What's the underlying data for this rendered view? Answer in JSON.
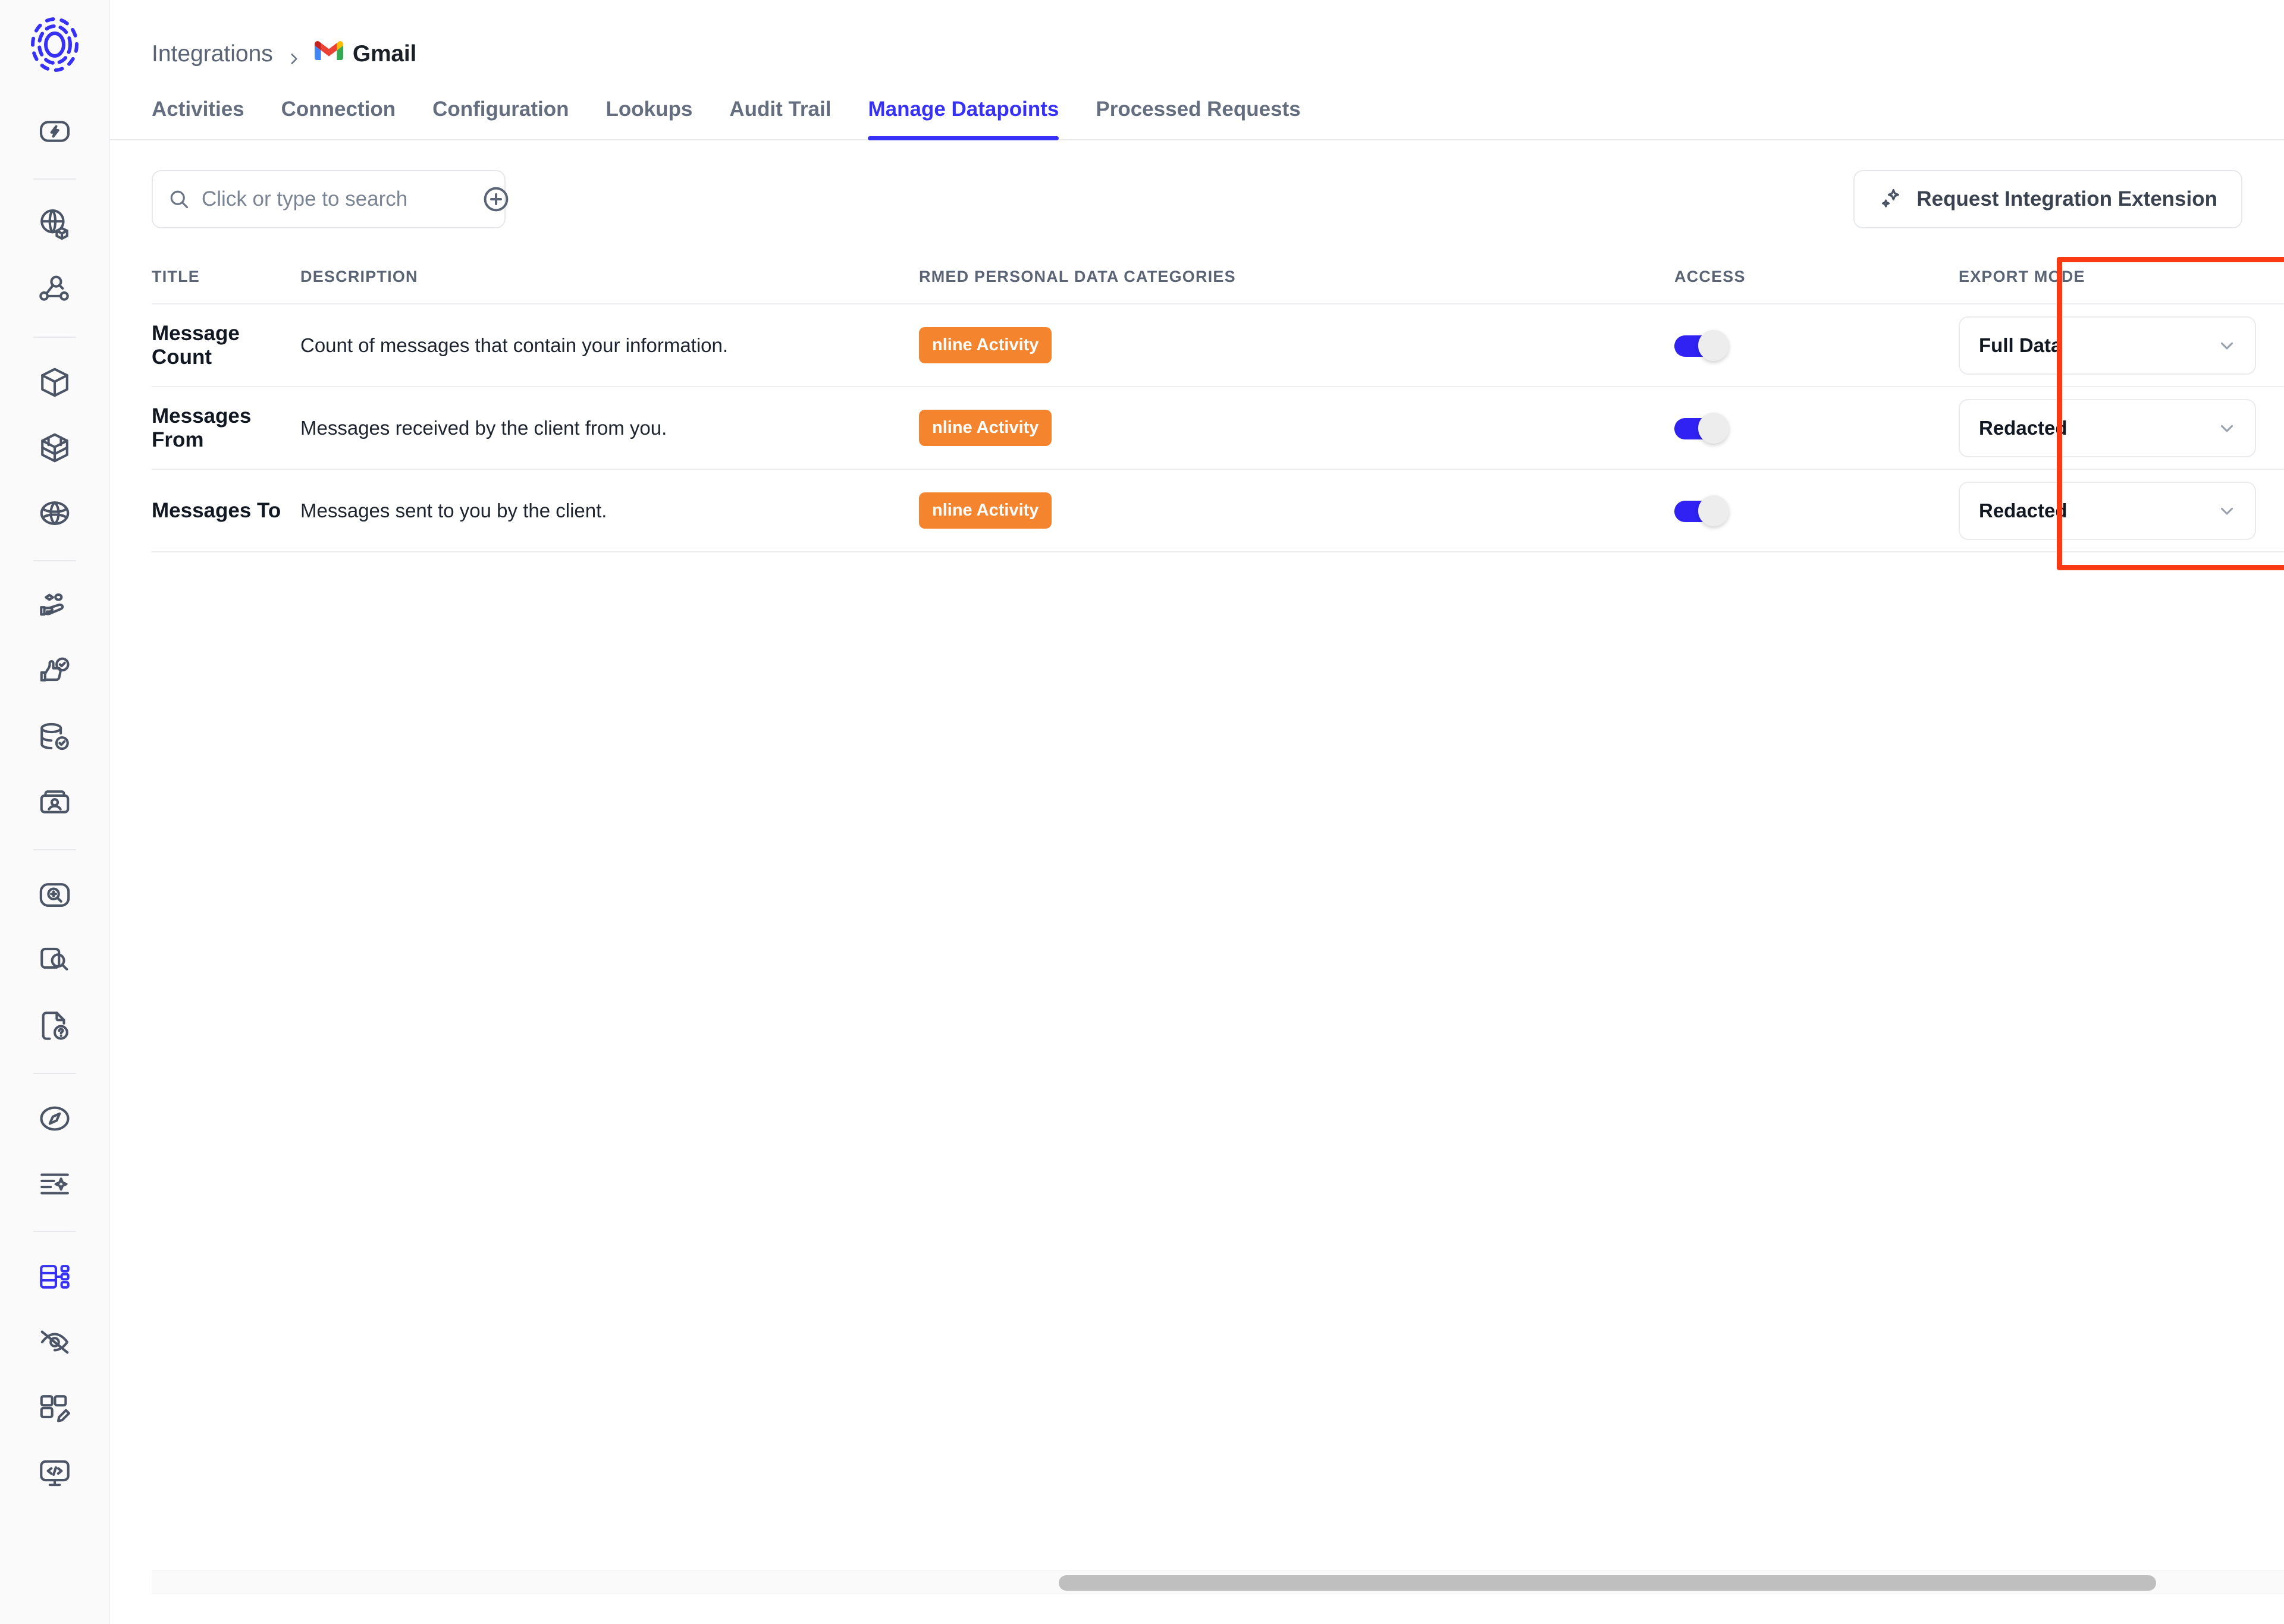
{
  "sidebar": {
    "logo_name": "company-logo",
    "groups": [
      {
        "items": [
          {
            "icon": "lightning-badge-icon",
            "name": "sidebar-item-automation"
          }
        ]
      },
      {
        "items": [
          {
            "icon": "globe-package-icon",
            "name": "sidebar-item-data-mapping"
          },
          {
            "icon": "node-search-icon",
            "name": "sidebar-item-discovery"
          }
        ]
      },
      {
        "items": [
          {
            "icon": "cube-icon",
            "name": "sidebar-item-assets"
          },
          {
            "icon": "grid-cube-icon",
            "name": "sidebar-item-inventory"
          },
          {
            "icon": "globe-icon",
            "name": "sidebar-item-global"
          }
        ]
      },
      {
        "items": [
          {
            "icon": "hand-data-icon",
            "name": "sidebar-item-consent"
          },
          {
            "icon": "thumbs-up-check-icon",
            "name": "sidebar-item-approvals"
          },
          {
            "icon": "database-check-icon",
            "name": "sidebar-item-databases"
          },
          {
            "icon": "id-card-icon",
            "name": "sidebar-item-subjects"
          }
        ]
      },
      {
        "items": [
          {
            "icon": "zoom-scan-icon",
            "name": "sidebar-item-scan"
          },
          {
            "icon": "window-search-icon",
            "name": "sidebar-item-page-scan"
          },
          {
            "icon": "file-question-icon",
            "name": "sidebar-item-requests"
          }
        ]
      },
      {
        "items": [
          {
            "icon": "compass-icon",
            "name": "sidebar-item-navigator"
          },
          {
            "icon": "list-sparkle-icon",
            "name": "sidebar-item-ai-assist"
          }
        ]
      },
      {
        "items": [
          {
            "icon": "datapoints-tree-icon",
            "name": "sidebar-item-datapoints",
            "active": true
          },
          {
            "icon": "eye-off-icon",
            "name": "sidebar-item-privacy"
          },
          {
            "icon": "layout-edit-icon",
            "name": "sidebar-item-templates"
          },
          {
            "icon": "code-monitor-icon",
            "name": "sidebar-item-developer"
          }
        ]
      }
    ]
  },
  "breadcrumb": {
    "root_label": "Integrations",
    "separator_icon": "chevron-right-icon",
    "current_icon": "gmail-icon",
    "current_label": "Gmail"
  },
  "tabs": [
    {
      "label": "Activities",
      "active": false
    },
    {
      "label": "Connection",
      "active": false
    },
    {
      "label": "Configuration",
      "active": false
    },
    {
      "label": "Lookups",
      "active": false
    },
    {
      "label": "Audit Trail",
      "active": false
    },
    {
      "label": "Manage Datapoints",
      "active": true
    },
    {
      "label": "Processed Requests",
      "active": false
    }
  ],
  "toolbar": {
    "search": {
      "icon": "search-icon",
      "placeholder": "Click or type to search",
      "value": "",
      "add_icon": "plus-circle-icon"
    },
    "request_button": {
      "icon": "sparkle-icon",
      "label": "Request Integration Extension"
    }
  },
  "table": {
    "columns": [
      {
        "key": "title",
        "label": "TITLE"
      },
      {
        "key": "description",
        "label": "DESCRIPTION"
      },
      {
        "key": "categories",
        "label": "RMED PERSONAL DATA CATEGORIES"
      },
      {
        "key": "access",
        "label": "ACCESS"
      },
      {
        "key": "export_mode",
        "label": "EXPORT MODE"
      }
    ],
    "rows": [
      {
        "title": "Message Count",
        "description": "Count of messages that contain your information.",
        "category_badge": "nline Activity",
        "access_on": true,
        "export_mode": "Full Data"
      },
      {
        "title": "Messages From",
        "description": "Messages received by the client from you.",
        "category_badge": "nline Activity",
        "access_on": true,
        "export_mode": "Redacted"
      },
      {
        "title": "Messages To",
        "description": "Messages sent to you by the client.",
        "category_badge": "nline Activity",
        "access_on": true,
        "export_mode": "Redacted"
      }
    ]
  },
  "annotation": {
    "name": "export-mode-highlight",
    "color": "#F93A12"
  },
  "colors": {
    "accent": "#3730F5",
    "toggle_on": "#2F22F2",
    "badge_orange": "#F5842F",
    "text_dark": "#121821",
    "text_muted": "#5A6474",
    "table_empty_bg": "#F7F8FA",
    "sidebar_bg": "#FAFAFB"
  },
  "scrollbar": {
    "orientation": "horizontal",
    "name": "horizontal-scrollbar"
  }
}
